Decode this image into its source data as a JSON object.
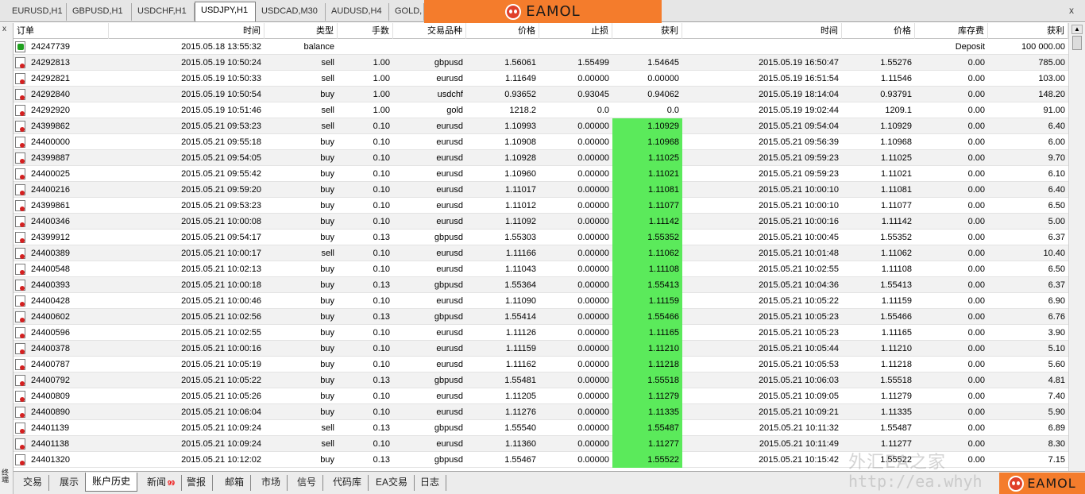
{
  "chart_tabs": [
    {
      "label": "EURUSD,H1",
      "active": false
    },
    {
      "label": "GBPUSD,H1",
      "active": false
    },
    {
      "label": "USDCHF,H1",
      "active": false
    },
    {
      "label": "USDJPY,H1",
      "active": true
    },
    {
      "label": "USDCAD,M30",
      "active": false
    },
    {
      "label": "AUDUSD,H4",
      "active": false
    },
    {
      "label": "GOLD,",
      "active": false
    }
  ],
  "banner": {
    "logo": "EAMOL"
  },
  "strip_close": "x",
  "toolbox": {
    "close": "x",
    "title": "终端"
  },
  "columns": [
    "订单",
    "时间",
    "类型",
    "手数",
    "交易品种",
    "价格",
    "止损",
    "获利",
    "时间",
    "价格",
    "库存费",
    "获利"
  ],
  "sort_marker": "/",
  "balance_row": {
    "order": "24247739",
    "time": "2015.05.18 13:55:32",
    "type": "balance",
    "comment": "Deposit",
    "profit": "100 000.00"
  },
  "rows": [
    {
      "order": "24292813",
      "open_time": "2015.05.19 10:50:24",
      "type": "sell",
      "lots": "1.00",
      "symbol": "gbpusd",
      "price": "1.56061",
      "sl": "1.55499",
      "tp": "1.54645",
      "close_time": "2015.05.19 16:50:47",
      "close_price": "1.55276",
      "swap": "0.00",
      "profit": "785.00",
      "tp_hit": false
    },
    {
      "order": "24292821",
      "open_time": "2015.05.19 10:50:33",
      "type": "sell",
      "lots": "1.00",
      "symbol": "eurusd",
      "price": "1.11649",
      "sl": "0.00000",
      "tp": "0.00000",
      "close_time": "2015.05.19 16:51:54",
      "close_price": "1.11546",
      "swap": "0.00",
      "profit": "103.00",
      "tp_hit": false
    },
    {
      "order": "24292840",
      "open_time": "2015.05.19 10:50:54",
      "type": "buy",
      "lots": "1.00",
      "symbol": "usdchf",
      "price": "0.93652",
      "sl": "0.93045",
      "tp": "0.94062",
      "close_time": "2015.05.19 18:14:04",
      "close_price": "0.93791",
      "swap": "0.00",
      "profit": "148.20",
      "tp_hit": false
    },
    {
      "order": "24292920",
      "open_time": "2015.05.19 10:51:46",
      "type": "sell",
      "lots": "1.00",
      "symbol": "gold",
      "price": "1218.2",
      "sl": "0.0",
      "tp": "0.0",
      "close_time": "2015.05.19 19:02:44",
      "close_price": "1209.1",
      "swap": "0.00",
      "profit": "91.00",
      "tp_hit": false
    },
    {
      "order": "24399862",
      "open_time": "2015.05.21 09:53:23",
      "type": "sell",
      "lots": "0.10",
      "symbol": "eurusd",
      "price": "1.10993",
      "sl": "0.00000",
      "tp": "1.10929",
      "close_time": "2015.05.21 09:54:04",
      "close_price": "1.10929",
      "swap": "0.00",
      "profit": "6.40",
      "tp_hit": true
    },
    {
      "order": "24400000",
      "open_time": "2015.05.21 09:55:18",
      "type": "buy",
      "lots": "0.10",
      "symbol": "eurusd",
      "price": "1.10908",
      "sl": "0.00000",
      "tp": "1.10968",
      "close_time": "2015.05.21 09:56:39",
      "close_price": "1.10968",
      "swap": "0.00",
      "profit": "6.00",
      "tp_hit": true
    },
    {
      "order": "24399887",
      "open_time": "2015.05.21 09:54:05",
      "type": "buy",
      "lots": "0.10",
      "symbol": "eurusd",
      "price": "1.10928",
      "sl": "0.00000",
      "tp": "1.11025",
      "close_time": "2015.05.21 09:59:23",
      "close_price": "1.11025",
      "swap": "0.00",
      "profit": "9.70",
      "tp_hit": true
    },
    {
      "order": "24400025",
      "open_time": "2015.05.21 09:55:42",
      "type": "buy",
      "lots": "0.10",
      "symbol": "eurusd",
      "price": "1.10960",
      "sl": "0.00000",
      "tp": "1.11021",
      "close_time": "2015.05.21 09:59:23",
      "close_price": "1.11021",
      "swap": "0.00",
      "profit": "6.10",
      "tp_hit": true
    },
    {
      "order": "24400216",
      "open_time": "2015.05.21 09:59:20",
      "type": "buy",
      "lots": "0.10",
      "symbol": "eurusd",
      "price": "1.11017",
      "sl": "0.00000",
      "tp": "1.11081",
      "close_time": "2015.05.21 10:00:10",
      "close_price": "1.11081",
      "swap": "0.00",
      "profit": "6.40",
      "tp_hit": true
    },
    {
      "order": "24399861",
      "open_time": "2015.05.21 09:53:23",
      "type": "buy",
      "lots": "0.10",
      "symbol": "eurusd",
      "price": "1.11012",
      "sl": "0.00000",
      "tp": "1.11077",
      "close_time": "2015.05.21 10:00:10",
      "close_price": "1.11077",
      "swap": "0.00",
      "profit": "6.50",
      "tp_hit": true
    },
    {
      "order": "24400346",
      "open_time": "2015.05.21 10:00:08",
      "type": "buy",
      "lots": "0.10",
      "symbol": "eurusd",
      "price": "1.11092",
      "sl": "0.00000",
      "tp": "1.11142",
      "close_time": "2015.05.21 10:00:16",
      "close_price": "1.11142",
      "swap": "0.00",
      "profit": "5.00",
      "tp_hit": true
    },
    {
      "order": "24399912",
      "open_time": "2015.05.21 09:54:17",
      "type": "buy",
      "lots": "0.13",
      "symbol": "gbpusd",
      "price": "1.55303",
      "sl": "0.00000",
      "tp": "1.55352",
      "close_time": "2015.05.21 10:00:45",
      "close_price": "1.55352",
      "swap": "0.00",
      "profit": "6.37",
      "tp_hit": true
    },
    {
      "order": "24400389",
      "open_time": "2015.05.21 10:00:17",
      "type": "sell",
      "lots": "0.10",
      "symbol": "eurusd",
      "price": "1.11166",
      "sl": "0.00000",
      "tp": "1.11062",
      "close_time": "2015.05.21 10:01:48",
      "close_price": "1.11062",
      "swap": "0.00",
      "profit": "10.40",
      "tp_hit": true
    },
    {
      "order": "24400548",
      "open_time": "2015.05.21 10:02:13",
      "type": "buy",
      "lots": "0.10",
      "symbol": "eurusd",
      "price": "1.11043",
      "sl": "0.00000",
      "tp": "1.11108",
      "close_time": "2015.05.21 10:02:55",
      "close_price": "1.11108",
      "swap": "0.00",
      "profit": "6.50",
      "tp_hit": true
    },
    {
      "order": "24400393",
      "open_time": "2015.05.21 10:00:18",
      "type": "buy",
      "lots": "0.13",
      "symbol": "gbpusd",
      "price": "1.55364",
      "sl": "0.00000",
      "tp": "1.55413",
      "close_time": "2015.05.21 10:04:36",
      "close_price": "1.55413",
      "swap": "0.00",
      "profit": "6.37",
      "tp_hit": true
    },
    {
      "order": "24400428",
      "open_time": "2015.05.21 10:00:46",
      "type": "buy",
      "lots": "0.10",
      "symbol": "eurusd",
      "price": "1.11090",
      "sl": "0.00000",
      "tp": "1.11159",
      "close_time": "2015.05.21 10:05:22",
      "close_price": "1.11159",
      "swap": "0.00",
      "profit": "6.90",
      "tp_hit": true
    },
    {
      "order": "24400602",
      "open_time": "2015.05.21 10:02:56",
      "type": "buy",
      "lots": "0.13",
      "symbol": "gbpusd",
      "price": "1.55414",
      "sl": "0.00000",
      "tp": "1.55466",
      "close_time": "2015.05.21 10:05:23",
      "close_price": "1.55466",
      "swap": "0.00",
      "profit": "6.76",
      "tp_hit": true
    },
    {
      "order": "24400596",
      "open_time": "2015.05.21 10:02:55",
      "type": "buy",
      "lots": "0.10",
      "symbol": "eurusd",
      "price": "1.11126",
      "sl": "0.00000",
      "tp": "1.11165",
      "close_time": "2015.05.21 10:05:23",
      "close_price": "1.11165",
      "swap": "0.00",
      "profit": "3.90",
      "tp_hit": true
    },
    {
      "order": "24400378",
      "open_time": "2015.05.21 10:00:16",
      "type": "buy",
      "lots": "0.10",
      "symbol": "eurusd",
      "price": "1.11159",
      "sl": "0.00000",
      "tp": "1.11210",
      "close_time": "2015.05.21 10:05:44",
      "close_price": "1.11210",
      "swap": "0.00",
      "profit": "5.10",
      "tp_hit": true
    },
    {
      "order": "24400787",
      "open_time": "2015.05.21 10:05:19",
      "type": "buy",
      "lots": "0.10",
      "symbol": "eurusd",
      "price": "1.11162",
      "sl": "0.00000",
      "tp": "1.11218",
      "close_time": "2015.05.21 10:05:53",
      "close_price": "1.11218",
      "swap": "0.00",
      "profit": "5.60",
      "tp_hit": true
    },
    {
      "order": "24400792",
      "open_time": "2015.05.21 10:05:22",
      "type": "buy",
      "lots": "0.13",
      "symbol": "gbpusd",
      "price": "1.55481",
      "sl": "0.00000",
      "tp": "1.55518",
      "close_time": "2015.05.21 10:06:03",
      "close_price": "1.55518",
      "swap": "0.00",
      "profit": "4.81",
      "tp_hit": true
    },
    {
      "order": "24400809",
      "open_time": "2015.05.21 10:05:26",
      "type": "buy",
      "lots": "0.10",
      "symbol": "eurusd",
      "price": "1.11205",
      "sl": "0.00000",
      "tp": "1.11279",
      "close_time": "2015.05.21 10:09:05",
      "close_price": "1.11279",
      "swap": "0.00",
      "profit": "7.40",
      "tp_hit": true
    },
    {
      "order": "24400890",
      "open_time": "2015.05.21 10:06:04",
      "type": "buy",
      "lots": "0.10",
      "symbol": "eurusd",
      "price": "1.11276",
      "sl": "0.00000",
      "tp": "1.11335",
      "close_time": "2015.05.21 10:09:21",
      "close_price": "1.11335",
      "swap": "0.00",
      "profit": "5.90",
      "tp_hit": true
    },
    {
      "order": "24401139",
      "open_time": "2015.05.21 10:09:24",
      "type": "sell",
      "lots": "0.13",
      "symbol": "gbpusd",
      "price": "1.55540",
      "sl": "0.00000",
      "tp": "1.55487",
      "close_time": "2015.05.21 10:11:32",
      "close_price": "1.55487",
      "swap": "0.00",
      "profit": "6.89",
      "tp_hit": true
    },
    {
      "order": "24401138",
      "open_time": "2015.05.21 10:09:24",
      "type": "sell",
      "lots": "0.10",
      "symbol": "eurusd",
      "price": "1.11360",
      "sl": "0.00000",
      "tp": "1.11277",
      "close_time": "2015.05.21 10:11:49",
      "close_price": "1.11277",
      "swap": "0.00",
      "profit": "8.30",
      "tp_hit": true
    },
    {
      "order": "24401320",
      "open_time": "2015.05.21 10:12:02",
      "type": "buy",
      "lots": "0.13",
      "symbol": "gbpusd",
      "price": "1.55467",
      "sl": "0.00000",
      "tp": "1.55522",
      "close_time": "2015.05.21 10:15:42",
      "close_price": "1.55522",
      "swap": "0.00",
      "profit": "7.15",
      "tp_hit": true
    }
  ],
  "terminal_tabs": [
    {
      "label": "交易",
      "active": false,
      "badge": ""
    },
    {
      "label": "展示",
      "active": false,
      "badge": ""
    },
    {
      "label": "账户历史",
      "active": true,
      "badge": ""
    },
    {
      "label": "新闻",
      "active": false,
      "badge": "99"
    },
    {
      "label": "警报",
      "active": false,
      "badge": ""
    },
    {
      "label": "邮箱",
      "active": false,
      "badge": ""
    },
    {
      "label": "市场",
      "active": false,
      "badge": ""
    },
    {
      "label": "信号",
      "active": false,
      "badge": ""
    },
    {
      "label": "代码库",
      "active": false,
      "badge": ""
    },
    {
      "label": "EA交易",
      "active": false,
      "badge": ""
    },
    {
      "label": "日志",
      "active": false,
      "badge": ""
    }
  ],
  "watermark": {
    "text": "外汇EA之家",
    "url": "http://ea.whyh"
  },
  "logo_badge": {
    "text": "EAMOL"
  },
  "colors": {
    "tp_highlight": "#5bea5b",
    "banner": "#f47c2c",
    "loss_icon": "#d42020",
    "deposit_icon": "#1fa01f"
  }
}
